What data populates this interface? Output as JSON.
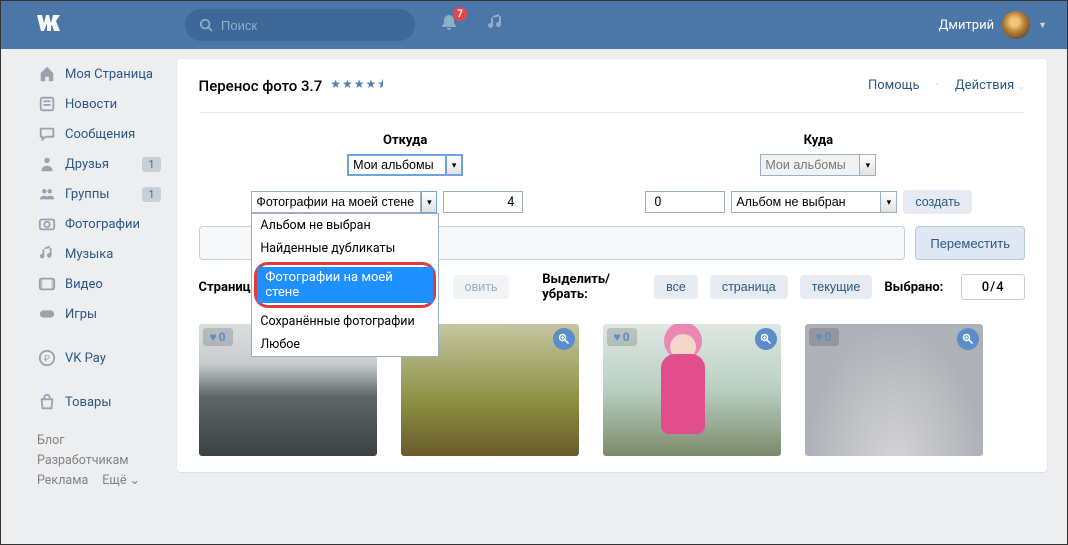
{
  "header": {
    "search_placeholder": "Поиск",
    "notif_count": "7",
    "user_name": "Дмитрий"
  },
  "sidebar": {
    "items": [
      {
        "label": "Моя Страница",
        "icon": "home"
      },
      {
        "label": "Новости",
        "icon": "news"
      },
      {
        "label": "Сообщения",
        "icon": "chat"
      },
      {
        "label": "Друзья",
        "icon": "friends",
        "badge": "1"
      },
      {
        "label": "Группы",
        "icon": "groups",
        "badge": "1"
      },
      {
        "label": "Фотографии",
        "icon": "photo"
      },
      {
        "label": "Музыка",
        "icon": "music"
      },
      {
        "label": "Видео",
        "icon": "video"
      },
      {
        "label": "Игры",
        "icon": "games"
      }
    ],
    "items2": [
      {
        "label": "VK Pay",
        "icon": "pay"
      }
    ],
    "items3": [
      {
        "label": "Товары",
        "icon": "bag"
      }
    ],
    "links": [
      "Блог",
      "Разработчикам",
      "Реклама",
      "Ещё ⌄"
    ]
  },
  "app": {
    "title": "Перенос фото 3.7",
    "stars": "★★★★⯨",
    "help": "Помощь",
    "actions": "Действия",
    "from_title": "Откуда",
    "to_title": "Куда",
    "from_source": "Мои альбомы",
    "to_source": "Мои альбомы",
    "from_album": "Фотографии на моей стене",
    "from_count": "4",
    "to_count": "0",
    "to_album": "Альбом не выбран",
    "create_btn": "создать",
    "move_btn": "Переместить",
    "page_label": "Страница:",
    "refresh_btn": "овить",
    "select_label": "Выделить/убрать:",
    "sel_all": "все",
    "sel_page": "страница",
    "sel_cur": "текущие",
    "selected_label": "Выбрано:",
    "selected_val": "0/4",
    "dropdown": {
      "opt0": "Альбом не выбран",
      "opt1": "Найденные дубликаты",
      "opt2": "Фотографии на моей стене",
      "opt3": "Сохранённые фотографии",
      "opt4": "Любое"
    },
    "like_txt": "0"
  }
}
